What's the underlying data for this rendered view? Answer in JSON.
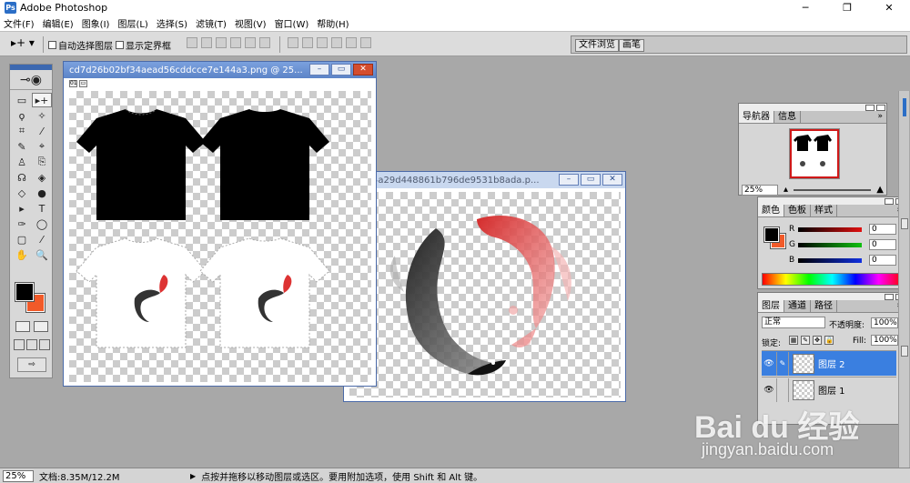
{
  "app": {
    "title": "Adobe Photoshop",
    "icon": "photoshop-icon",
    "minimize": "─",
    "maximize": "❐",
    "close": "✕"
  },
  "menu": [
    "文件(F)",
    "编辑(E)",
    "图象(I)",
    "图层(L)",
    "选择(S)",
    "滤镜(T)",
    "视图(V)",
    "窗口(W)",
    "帮助(H)"
  ],
  "options": {
    "tool_preset": "▸+ ▾",
    "auto_select": "自动选择图层",
    "show_bounds": "显示定界框",
    "palette_well_tabs": [
      "文件浏览",
      "画笔"
    ]
  },
  "toolbox": {
    "logo": "⊸◉",
    "tools": [
      "▭",
      "▸+",
      "ϙ",
      "✧",
      "⌗",
      "⁄",
      "✎",
      "⌖",
      "♙",
      "⎘",
      "☊",
      "◈",
      "◇",
      "●",
      "▸",
      "T",
      "✑",
      "◯",
      "▢",
      "⁄",
      "✋",
      "🔍"
    ],
    "fg_color": "#000000",
    "bg_color": "#f15a29"
  },
  "documents": [
    {
      "title": "cd7d26b02bf34aead56cddcce7e144a3.png @ 25...",
      "active": true
    },
    {
      "title": "a4e64a29d448861b796de9531b8ada.p...",
      "active": false
    }
  ],
  "navigator": {
    "tabs": [
      "导航器",
      "信息"
    ],
    "zoom": "25%",
    "menu": "»"
  },
  "color_palette": {
    "tabs": [
      "颜色",
      "色板",
      "样式"
    ],
    "channels": [
      {
        "name": "R",
        "value": "0",
        "color": "#b01010"
      },
      {
        "name": "G",
        "value": "0",
        "color": "#10a010"
      },
      {
        "name": "B",
        "value": "0",
        "color": "#1020b0"
      }
    ]
  },
  "layers_palette": {
    "tabs": [
      "图层",
      "通道",
      "路径"
    ],
    "blend_mode": "正常",
    "opacity_label": "不透明度:",
    "opacity": "100%",
    "lock_label": "锁定:",
    "fill_label": "Fill:",
    "fill": "100%",
    "layers": [
      {
        "name": "图层 2",
        "selected": true
      },
      {
        "name": "图层 1",
        "selected": false
      }
    ]
  },
  "status": {
    "zoom": "25%",
    "doc_size": "文档:8.35M/12.2M",
    "hint": "点按并拖移以移动图层或选区。要用附加选项，使用 Shift 和 Alt 键。"
  },
  "watermark": {
    "logo": "Bai du 经验",
    "url": "jingyan.baidu.com"
  },
  "colors": {
    "accent": "#3a7fe0",
    "bg_swatch": "#f15a29",
    "titlebar_active": "#5c84c8"
  }
}
